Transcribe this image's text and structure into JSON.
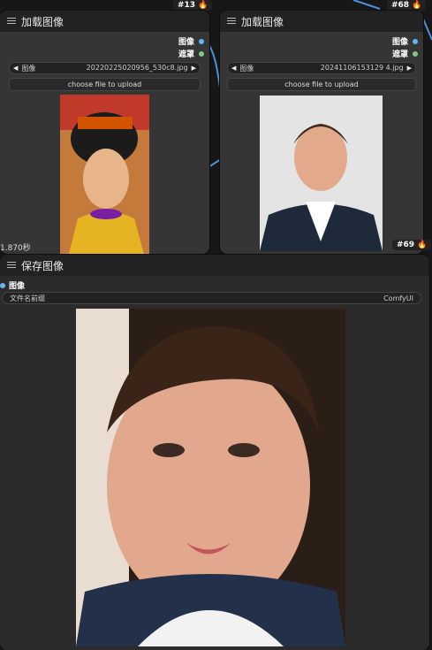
{
  "nodes": {
    "load1": {
      "title": "加载图像",
      "outputs": [
        "图像",
        "遮罩"
      ],
      "image_label": "图像",
      "image_value": "20220225020956_530c8.jpg",
      "upload_label": "choose file to upload",
      "badge": "#13",
      "timing": "1.870秒"
    },
    "load2": {
      "title": "加载图像",
      "outputs": [
        "图像",
        "遮罩"
      ],
      "image_label": "图像",
      "image_value": "20241106153129 4.jpg",
      "upload_label": "choose file to upload",
      "badge_top": "#68",
      "badge_bottom": "#69"
    },
    "save": {
      "title": "保存图像",
      "input": "图像",
      "prefix_label": "文件名前缀",
      "prefix_value": "ComfyUI"
    }
  },
  "colors": {
    "image_socket": "#64b5f6",
    "mask_socket": "#81c784",
    "wire": "#4a90d9",
    "header": "#222222",
    "node_body": "#353535"
  }
}
